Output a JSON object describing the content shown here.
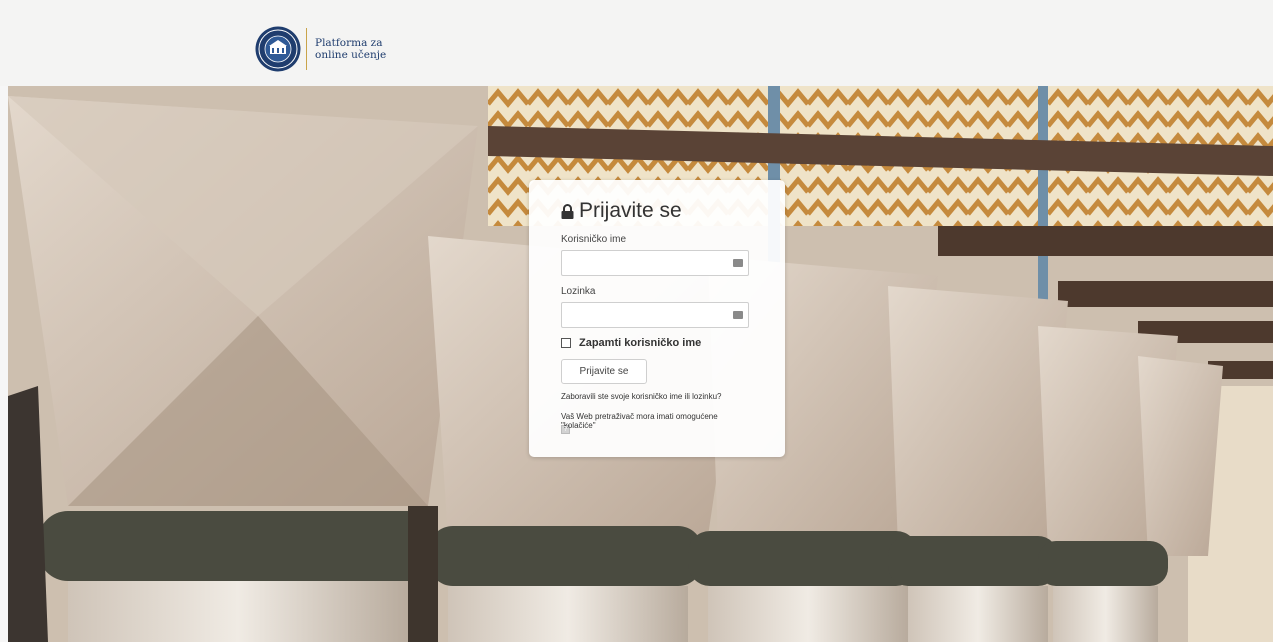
{
  "header": {
    "logo_line1": "Platforma za",
    "logo_line2": "online učenje"
  },
  "login": {
    "title": "Prijavite se",
    "username_label": "Korisničko ime",
    "username_value": "",
    "password_label": "Lozinka",
    "password_value": "",
    "remember_label": "Zapamti korisničko ime",
    "remember_checked": false,
    "submit_label": "Prijavite se",
    "forgot_link": "Zaboravili ste svoje korisničko ime ili lozinku?",
    "cookies_note": "Vaš Web pretraživač mora imati omogućene \"kolačiće\"",
    "help_icon": "help-icon"
  },
  "colors": {
    "header_bg": "#f4f4f3",
    "seal_blue": "#1f3d6e",
    "accent_gold": "#c9a44a"
  }
}
